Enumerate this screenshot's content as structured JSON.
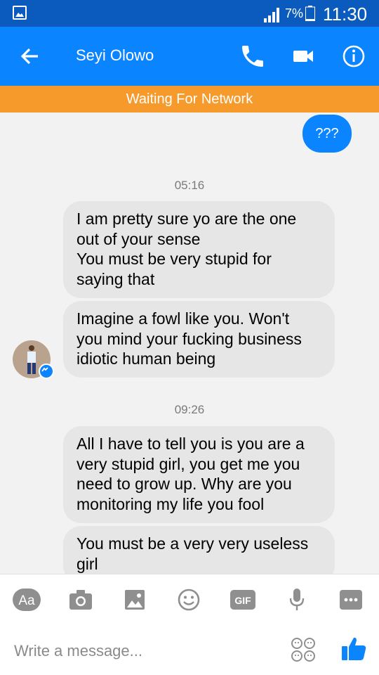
{
  "status_bar": {
    "battery_percent": "7%",
    "time": "11:30",
    "icons": [
      "gallery-icon",
      "signal-icon",
      "battery-icon"
    ]
  },
  "header": {
    "contact_name": "Seyi Olowo",
    "icons": [
      "back-arrow-icon",
      "phone-icon",
      "video-camera-icon",
      "info-icon"
    ],
    "color": "#0a84ff"
  },
  "network_banner": {
    "text": "Waiting For Network",
    "color": "#f59a2b"
  },
  "conversation": {
    "outgoing_message": "???",
    "groups": [
      {
        "timestamp": "05:16",
        "messages": [
          "I am pretty sure yo are the one\nout of your sense\nYou must be very stupid for\nsaying that",
          "Imagine a fowl like you. Won't\nyou mind your fucking business\nidiotic human being"
        ]
      },
      {
        "timestamp": "09:26",
        "messages": [
          "All I have to tell you is you are a\nvery stupid girl, you get me you\nneed to grow up. Why are you\nmonitoring my life you fool",
          "You must be a very very useless\ngirl"
        ]
      }
    ]
  },
  "composer": {
    "toolbar": {
      "text_label": "Aa",
      "gif_label": "GIF",
      "icons": [
        "text-format-icon",
        "camera-icon",
        "image-icon",
        "emoji-icon",
        "gif-icon",
        "microphone-icon",
        "more-icon"
      ]
    },
    "placeholder": "Write a message...",
    "icons": [
      "emoji-picker-icon",
      "thumbs-up-icon"
    ]
  }
}
